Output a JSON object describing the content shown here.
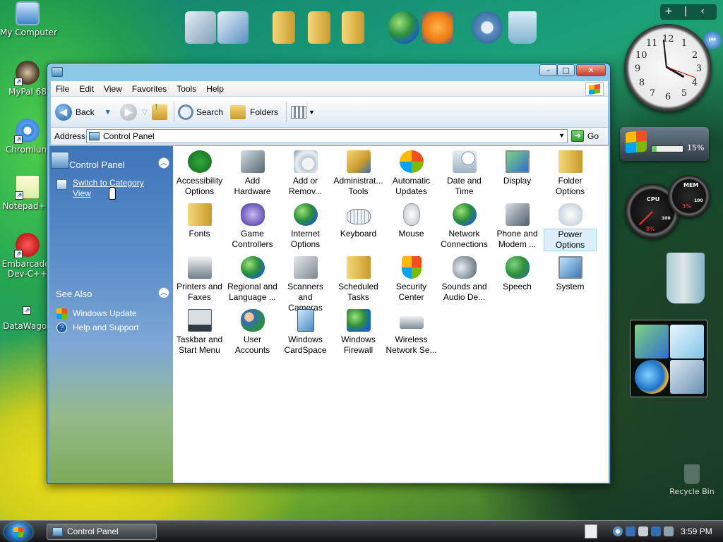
{
  "desktop": {
    "icons": [
      {
        "label": "My Computer"
      },
      {
        "label": "MyPal 68"
      },
      {
        "label": "Chromium"
      },
      {
        "label": "Notepad++"
      },
      {
        "label": "Embarcader Dev-C++",
        "line1": "Embarcader",
        "line2": "Dev-C++"
      },
      {
        "label": "DataWagon"
      }
    ],
    "recycle_bin": "Recycle Bin"
  },
  "gadgets": {
    "controls": {
      "add": "+",
      "split": "|"
    },
    "clock_numbers": [
      "12",
      "1",
      "2",
      "3",
      "4",
      "5",
      "6",
      "7",
      "8",
      "9",
      "10",
      "11"
    ],
    "battery_percent": "15%",
    "battery_fraction": 0.15,
    "cpu_label": "CPU",
    "cpu_value": "8%",
    "cpu_scale": "100",
    "mem_label": "MEM",
    "mem_value": "3%",
    "mem_scale": "100"
  },
  "window": {
    "title_controls": {
      "minimize": "–",
      "maximize": "□",
      "close": "✕"
    },
    "menu": [
      "File",
      "Edit",
      "View",
      "Favorites",
      "Tools",
      "Help"
    ],
    "toolbar": {
      "back": "Back",
      "search": "Search",
      "folders": "Folders"
    },
    "address": {
      "label": "Address",
      "value": "Control Panel",
      "go": "Go"
    },
    "taskpane": {
      "section1_title": "Control Panel",
      "switch_link": "Switch to Category View",
      "switch_line1": "Switch to Category",
      "switch_line2": "View",
      "section2_title": "See Also",
      "see_also": [
        "Windows Update",
        "Help and Support"
      ]
    },
    "items": [
      {
        "line1": "Accessibility",
        "line2": "Options",
        "icon": "accessibility-icon"
      },
      {
        "line1": "Add",
        "line2": "Hardware",
        "icon": "add-hardware-icon"
      },
      {
        "line1": "Add or",
        "line2": "Remov...",
        "icon": "add-remove-programs-icon"
      },
      {
        "line1": "Administrat...",
        "line2": "Tools",
        "icon": "administrative-tools-icon"
      },
      {
        "line1": "Automatic",
        "line2": "Updates",
        "icon": "automatic-updates-icon"
      },
      {
        "line1": "Date and",
        "line2": "Time",
        "icon": "date-time-icon"
      },
      {
        "line1": "Display",
        "line2": "",
        "icon": "display-icon"
      },
      {
        "line1": "Folder",
        "line2": "Options",
        "icon": "folder-options-icon"
      },
      {
        "line1": "Fonts",
        "line2": "",
        "icon": "fonts-icon"
      },
      {
        "line1": "Game",
        "line2": "Controllers",
        "icon": "game-controllers-icon"
      },
      {
        "line1": "Internet",
        "line2": "Options",
        "icon": "internet-options-icon"
      },
      {
        "line1": "Keyboard",
        "line2": "",
        "icon": "keyboard-icon"
      },
      {
        "line1": "Mouse",
        "line2": "",
        "icon": "mouse-icon"
      },
      {
        "line1": "Network",
        "line2": "Connections",
        "icon": "network-connections-icon"
      },
      {
        "line1": "Phone and",
        "line2": "Modem ...",
        "icon": "phone-modem-icon"
      },
      {
        "line1": "Power",
        "line2": "Options",
        "icon": "power-options-icon"
      },
      {
        "line1": "Printers and",
        "line2": "Faxes",
        "icon": "printers-faxes-icon"
      },
      {
        "line1": "Regional and",
        "line2": "Language ...",
        "icon": "regional-language-icon"
      },
      {
        "line1": "Scanners and",
        "line2": "Cameras",
        "icon": "scanners-cameras-icon"
      },
      {
        "line1": "Scheduled",
        "line2": "Tasks",
        "icon": "scheduled-tasks-icon"
      },
      {
        "line1": "Security",
        "line2": "Center",
        "icon": "security-center-icon"
      },
      {
        "line1": "Sounds and",
        "line2": "Audio De...",
        "icon": "sounds-audio-icon"
      },
      {
        "line1": "Speech",
        "line2": "",
        "icon": "speech-icon"
      },
      {
        "line1": "System",
        "line2": "",
        "icon": "system-icon"
      },
      {
        "line1": "Taskbar and",
        "line2": "Start Menu",
        "icon": "taskbar-start-menu-icon"
      },
      {
        "line1": "User",
        "line2": "Accounts",
        "icon": "user-accounts-icon"
      },
      {
        "line1": "Windows",
        "line2": "CardSpace",
        "icon": "windows-cardspace-icon"
      },
      {
        "line1": "Windows",
        "line2": "Firewall",
        "icon": "windows-firewall-icon"
      },
      {
        "line1": "Wireless",
        "line2": "Network Se...",
        "icon": "wireless-network-icon"
      }
    ]
  },
  "taskbar": {
    "task_label": "Control Panel",
    "time": "3:59 PM"
  },
  "colors": {
    "window_frame": "#8fc7e8",
    "taskpane_top": "#3f74b8",
    "selection": "#dbeefa",
    "taskbar": "#121416"
  }
}
